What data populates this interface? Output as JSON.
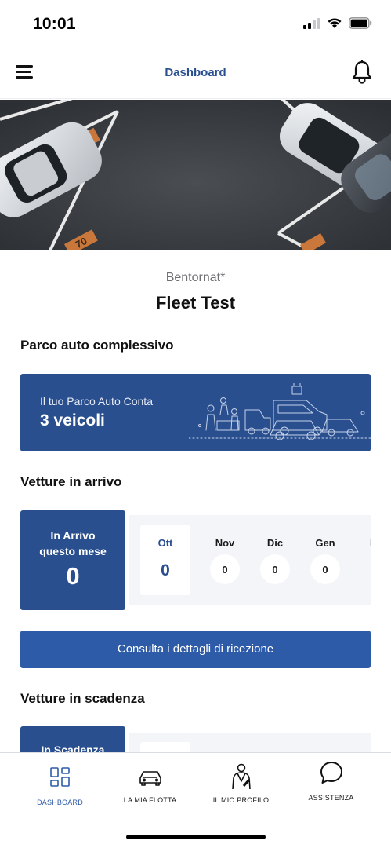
{
  "status_bar": {
    "time": "10:01"
  },
  "header": {
    "title": "Dashboard",
    "menu_icon": "hamburger-menu-icon",
    "notification_icon": "bell-icon"
  },
  "hero": {
    "image": "aerial parking lot with parked cars"
  },
  "greeting": {
    "salutation": "Bentornat*",
    "name": "Fleet Test"
  },
  "fleet_section": {
    "title": "Parco auto complessivo",
    "card_label": "Il tuo Parco Auto Conta",
    "card_value": "3 veicoli"
  },
  "arrivals_section": {
    "title": "Vetture in arrivo",
    "summary_label": "In Arrivo questo mese",
    "summary_count": "0",
    "months": [
      {
        "name": "Ott",
        "value": "0"
      },
      {
        "name": "Nov",
        "value": "0"
      },
      {
        "name": "Dic",
        "value": "0"
      },
      {
        "name": "Gen",
        "value": "0"
      },
      {
        "name": "F",
        "value": ""
      }
    ],
    "details_button": "Consulta i dettagli di ricezione"
  },
  "expiring_section": {
    "title": "Vetture in scadenza",
    "summary_label": "In Scadenza"
  },
  "bottom_nav": [
    {
      "label": "DASHBOARD",
      "icon": "dashboard-grid-icon",
      "active": true
    },
    {
      "label": "LA MIA FLOTTA",
      "icon": "car-icon",
      "active": false
    },
    {
      "label": "IL MIO PROFILO",
      "icon": "driver-profile-icon",
      "active": false
    },
    {
      "label": "ASSISTENZA",
      "icon": "chat-bubble-icon",
      "active": false
    }
  ],
  "colors": {
    "primary": "#2a4f8f",
    "button": "#2d5ba8",
    "strip": "#f4f5f8"
  }
}
